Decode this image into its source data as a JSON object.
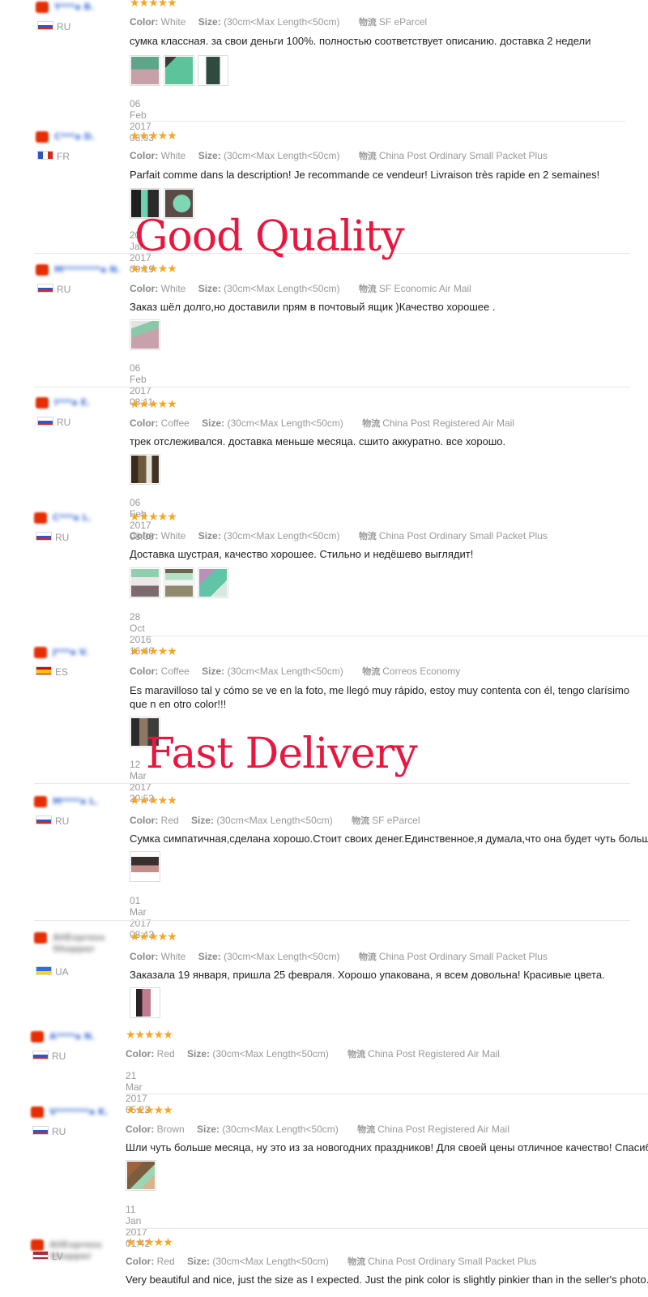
{
  "reviews": [
    {
      "user": "Y***a B.",
      "country": "RU",
      "color": "White",
      "size": "(30cm<Max Length<50cm)",
      "shipping": "SF eParcel",
      "text": "сумка классная. за свои деньги 100%. полностью соответствует описанию. доставка 2 недели",
      "date": "06 Feb 2017 08:03",
      "stars": "★★★★★"
    },
    {
      "user": "C***a D.",
      "country": "FR",
      "color": "White",
      "size": "(30cm<Max Length<50cm)",
      "shipping": "China Post Ordinary Small Packet Plus",
      "text": "Parfait comme dans la description! Je recommande ce vendeur! Livraison très rapide en 2 semaines!",
      "date": "20 Jan 2017 09:19",
      "stars": "★★★★★"
    },
    {
      "user": "M********a N.",
      "country": "RU",
      "color": "White",
      "size": "(30cm<Max Length<50cm)",
      "shipping": "SF Economic Air Mail",
      "text": "Заказ шёл долго,но доставили прям в почтовый ящик )Качество хорошее .",
      "date": "06 Feb 2017 08:11",
      "stars": "★★★★★"
    },
    {
      "user": "I***a E.",
      "country": "RU",
      "color": "Coffee",
      "size": "(30cm<Max Length<50cm)",
      "shipping": "China Post Registered Air Mail",
      "text": "трек отслеживался. доставка меньше месяца. сшито аккуратно. все хорошо.",
      "date": "06 Feb 2017 08:06",
      "stars": "★★★★★"
    },
    {
      "user": "C***a L.",
      "country": "RU",
      "color": "White",
      "size": "(30cm<Max Length<50cm)",
      "shipping": "China Post Ordinary Small Packet Plus",
      "text": "Доставка шустрая, качество хорошее. Стильно и недёшево выглядит!",
      "date": "28 Oct 2016 16:40",
      "stars": "★★★★★"
    },
    {
      "user": "J***a V.",
      "country": "ES",
      "color": "Coffee",
      "size": "(30cm<Max Length<50cm)",
      "shipping": "Correos Economy",
      "text": "Es maravilloso tal y cómo se ve en la foto, me llegó muy rápido, estoy muy contenta con él, tengo clarísimo que n en otro color!!!",
      "date": "12 Mar 2017 20:53",
      "stars": "★★★★★"
    },
    {
      "user": "M****a L.",
      "country": "RU",
      "color": "Red",
      "size": "(30cm<Max Length<50cm)",
      "shipping": "SF eParcel",
      "text": "Сумка симпатичная,сделана хорошо.Стоит своих денег.Единственное,я думала,что она будет чуть больше",
      "date": "01 Mar 2017 08:43",
      "stars": "★★★★★"
    },
    {
      "user": "AliExpress Shopper",
      "country": "UA",
      "color": "White",
      "size": "(30cm<Max Length<50cm)",
      "shipping": "China Post Ordinary Small Packet Plus",
      "text": "Заказала 19 января, пришла 25 февраля. Хорошо упакована, я всем довольна! Красивые цвета.",
      "date": "",
      "stars": "★★★★★"
    },
    {
      "user": "A****a N.",
      "country": "RU",
      "color": "Red",
      "size": "(30cm<Max Length<50cm)",
      "shipping": "China Post Registered Air Mail",
      "text": "",
      "date": "21 Mar 2017 05:22",
      "stars": "★★★★★"
    },
    {
      "user": "V*******a K.",
      "country": "RU",
      "color": "Brown",
      "size": "(30cm<Max Length<50cm)",
      "shipping": "China Post Registered Air Mail",
      "text": "Шли чуть больше месяца, ну это из за новогодних праздников! Для своей цены отличное качество! Спасибо",
      "date": "11 Jan 2017 01:42",
      "stars": "★★★★★"
    },
    {
      "user": "AliExpress Shopper",
      "country": "LV",
      "color": "Red",
      "size": "(30cm<Max Length<50cm)",
      "shipping": "China Post Ordinary Small Packet Plus",
      "text": "Very beautiful and nice, just the size as I expected. Just the pink color is slightly pinkier than in the seller's photo.",
      "date": "",
      "stars": "★★★★★"
    }
  ],
  "labels": {
    "color": "Color:",
    "size": "Size:",
    "logistics": "物流"
  },
  "overlays": {
    "good_quality": "Good Quality",
    "fast_delivery": "Fast Delivery"
  },
  "colors": {
    "accent": "#e8173f",
    "star": "#f5a623",
    "link": "#3d6ed6"
  }
}
